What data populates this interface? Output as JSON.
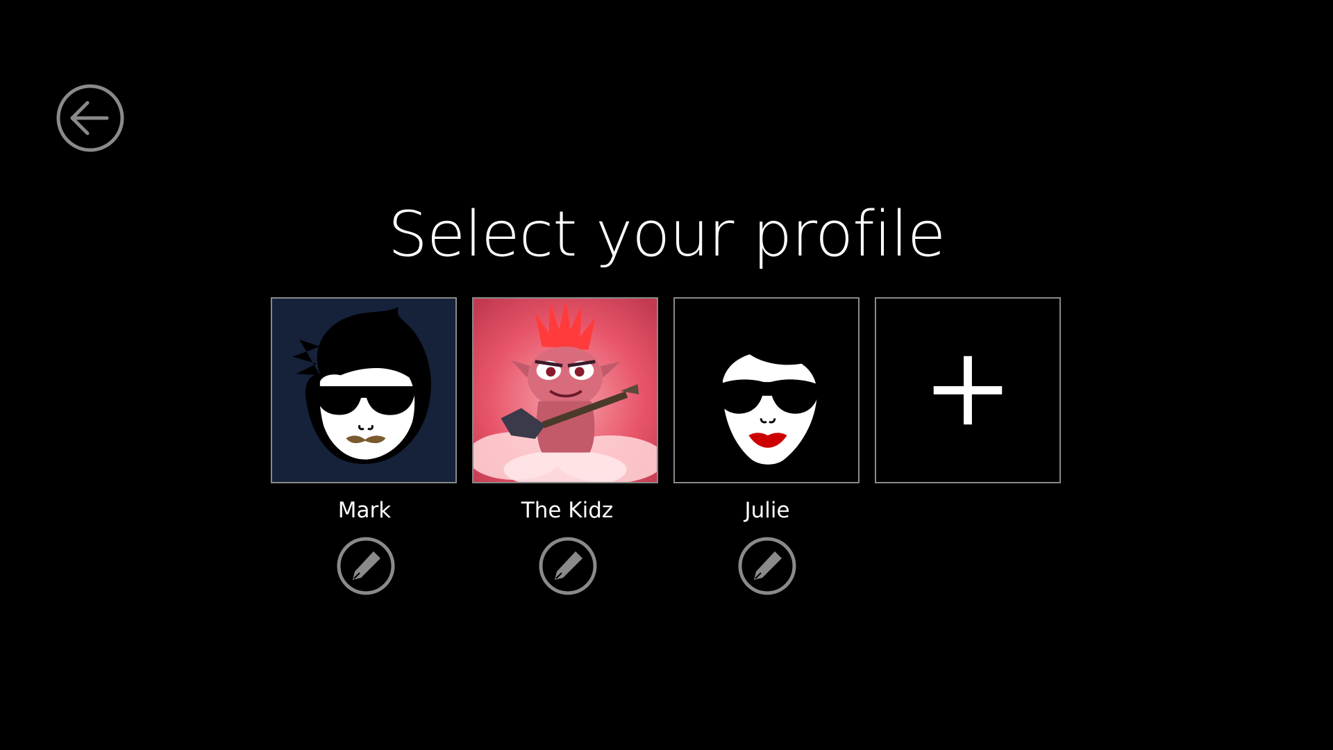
{
  "header": {
    "back_icon": "back-arrow-icon",
    "title": "Select your profile"
  },
  "profiles": [
    {
      "name": "Mark",
      "avatar": "man-sunglasses-mustache-avatar",
      "edit_icon": "pencil-icon",
      "accent": "#16213a"
    },
    {
      "name": "The Kidz",
      "avatar": "troll-rocker-guitar-avatar",
      "edit_icon": "pencil-icon",
      "accent": "#e8556a"
    },
    {
      "name": "Julie",
      "avatar": "woman-sunglasses-red-lips-avatar",
      "edit_icon": "pencil-icon",
      "accent": "#cc0000"
    }
  ],
  "add_profile": {
    "icon": "plus-icon"
  },
  "colors": {
    "background": "#000000",
    "text": "#ffffff",
    "outline": "#8a8a8a"
  }
}
